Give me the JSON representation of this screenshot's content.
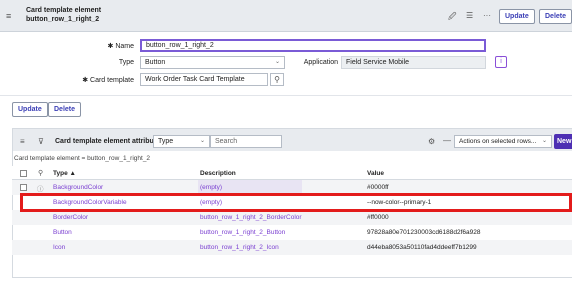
{
  "header": {
    "title_line1": "Card template element",
    "title_line2": "button_row_1_right_2",
    "update_label": "Update",
    "delete_label": "Delete"
  },
  "form": {
    "name_label": "Name",
    "name_value": "button_row_1_right_2",
    "type_label": "Type",
    "type_value": "Button",
    "application_label": "Application",
    "application_value": "Field Service Mobile",
    "card_template_label": "Card template",
    "card_template_value": "Work Order Task Card Template",
    "required_marker": "✱"
  },
  "actions": {
    "update_label": "Update",
    "delete_label": "Delete"
  },
  "related_list": {
    "title": "Card template element attributes",
    "filter_field": "Type",
    "search_placeholder": "Search",
    "actions_select": "Actions on selected rows...",
    "new_label": "New",
    "breadcrumb": "Card template element = button_row_1_right_2",
    "columns": {
      "type": "Type ▲",
      "description": "Description",
      "value": "Value"
    },
    "rows": [
      {
        "type": "BackgroundColor",
        "description": "(empty)",
        "value": "#0000ff"
      },
      {
        "type": "BackgroundColorVariable",
        "description": "(empty)",
        "value": "--now-color--primary-1"
      },
      {
        "type": "BorderColor",
        "description": "button_row_1_right_2_BorderColor",
        "value": "#ff0000"
      },
      {
        "type": "Button",
        "description": "button_row_1_right_2_Button",
        "value": "97828a80e701230003cd6188d2f6a928"
      },
      {
        "type": "Icon",
        "description": "button_row_1_right_2_Icon",
        "value": "d44eba8053a50110fad4ddeeff7b1299"
      }
    ]
  }
}
